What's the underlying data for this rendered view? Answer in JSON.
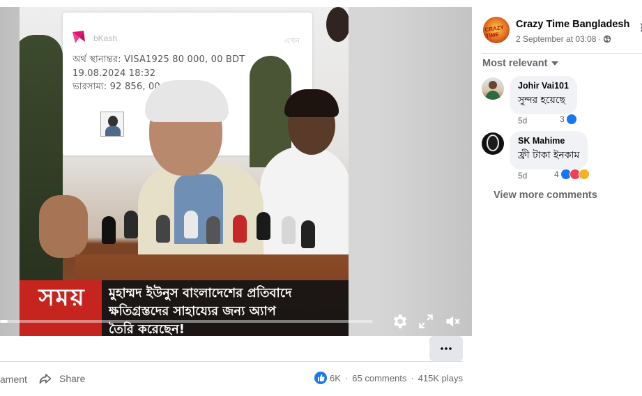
{
  "video": {
    "bkash_card": {
      "brand": "bKash",
      "status": "এখন",
      "line1": "অর্থ স্থানান্তর: VISA1925   80 000, 00 BDT",
      "line2": "19.08.2024 18:32",
      "line3": "ভারসাম্য:  92 856, 00 BDT"
    },
    "news": {
      "channel": "সময়",
      "headline_1": "মুহাম্মদ ইউনুস বাংলাদেশের প্রতিবাদে",
      "headline_2": "ক্ষতিগ্রস্তদের সাহায্যের জন্য অ্যাপ",
      "headline_3": "তৈরি করেছেন!"
    },
    "progress": 0.02
  },
  "post_actions": {
    "comment_label": "ament",
    "share_label": "Share",
    "reactions_count": "6K",
    "comments_count": "65 comments",
    "plays_count": "415K plays",
    "separator": "·"
  },
  "right_pane": {
    "page_name": "Crazy Time Bangladesh",
    "avatar_text": "CRAZY TIME",
    "post_time": "2 September at 03:08",
    "dot": "·",
    "sort_label": "Most relevant",
    "comments": [
      {
        "author": "Johir Vai101",
        "text": "সুন্দর হয়েছে",
        "time": "5d",
        "reactions": "3"
      },
      {
        "author": "SK Mahime",
        "text": "ফ্রী টাকা ইনকাম",
        "time": "5d",
        "reactions": "4"
      }
    ],
    "view_more": "View more comments"
  },
  "colors": {
    "accent": "#1877f2",
    "news_red": "#c6241f",
    "text_secondary": "#65676b"
  }
}
